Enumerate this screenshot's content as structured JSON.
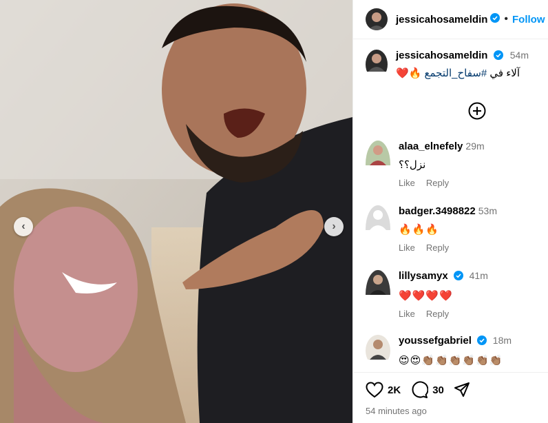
{
  "post": {
    "username": "jessicahosameldin",
    "follow_label": "Follow",
    "caption_time": "54m",
    "caption_text": "آلاء في ",
    "caption_hashtag": "#سفاح_التجمع",
    "caption_emojis": "🔥❤️"
  },
  "comments": [
    {
      "username": "alaa_elnefely",
      "time": "29m",
      "text": "نزل؟؟",
      "like": "Like",
      "reply": "Reply",
      "verified": false
    },
    {
      "username": "badger.3498822",
      "time": "53m",
      "text": "🔥🔥🔥",
      "like": "Like",
      "reply": "Reply",
      "verified": false
    },
    {
      "username": "lillysamyx",
      "time": "41m",
      "text": "❤️❤️❤️❤️",
      "like": "Like",
      "reply": "Reply",
      "verified": true
    },
    {
      "username": "youssefgabriel",
      "time": "18m",
      "text": "😍😍👏🏽👏🏽👏🏽👏🏽👏🏽👏🏽",
      "like": "",
      "reply": "",
      "verified": true
    }
  ],
  "footer": {
    "likes": "2K",
    "comments": "30",
    "posted_ago": "54 minutes ago"
  },
  "colors": {
    "accent": "#0095f6",
    "verified": "#0095f6",
    "muted": "#737373"
  },
  "icons": {
    "prev": "chevron-left-icon",
    "next": "chevron-right-icon",
    "add": "plus-circle-icon",
    "like": "heart-icon",
    "comment": "comment-icon",
    "share": "send-icon"
  }
}
